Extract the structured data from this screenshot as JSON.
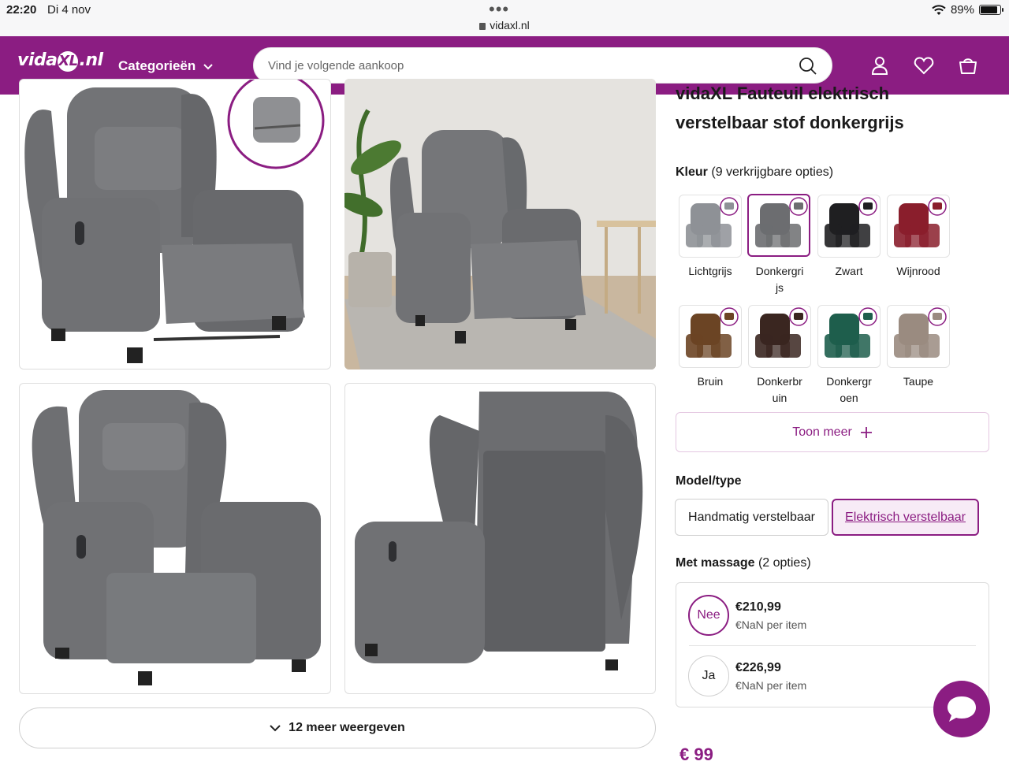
{
  "status": {
    "time": "22:20",
    "date": "Di 4 nov",
    "url": "vidaxl.nl",
    "battery": "89%",
    "battery_level": 0.89
  },
  "header": {
    "logo_text": "vidaXL.nl",
    "categories_label": "Categorieën",
    "search_placeholder": "Vind je volgende aankoop"
  },
  "gallery": {
    "more_label": "12 meer weergeven"
  },
  "product": {
    "title_partial": "vidaXL Fauteuil elektrisch",
    "title_line2": "verstelbaar stof donkergrijs",
    "color_label": "Kleur",
    "color_count": "(9 verkrijgbare opties)",
    "colors": [
      {
        "name": "Lichtgrijs",
        "hex": "#8e9196",
        "selected": false
      },
      {
        "name": "Donkergri js",
        "hex": "#6c6d70",
        "selected": true
      },
      {
        "name": "Zwart",
        "hex": "#1f1f21",
        "selected": false
      },
      {
        "name": "Wijnrood",
        "hex": "#8a1e2c",
        "selected": false
      },
      {
        "name": "Bruin",
        "hex": "#6b4424",
        "selected": false
      },
      {
        "name": "Donkerbr uin",
        "hex": "#3a2620",
        "selected": false
      },
      {
        "name": "Donkergr oen",
        "hex": "#1e5e4c",
        "selected": false
      },
      {
        "name": "Taupe",
        "hex": "#9a8b80",
        "selected": false
      }
    ],
    "show_more_label": "Toon meer",
    "model_label": "Model/type",
    "models": [
      {
        "label": "Handmatig verstelbaar",
        "selected": false
      },
      {
        "label": "Elektrisch verstelbaar",
        "selected": true
      }
    ],
    "massage_label": "Met massage",
    "massage_count": "(2 opties)",
    "massage_options": [
      {
        "short": "Nee",
        "price": "€210,99",
        "unit": "€NaN per item",
        "selected": true
      },
      {
        "short": "Ja",
        "price": "€226,99",
        "unit": "€NaN per item",
        "selected": false
      }
    ],
    "price_peek": "€ 99"
  },
  "colors": {
    "brand": "#8b1d82",
    "chair_gray": "#6c6d70"
  }
}
